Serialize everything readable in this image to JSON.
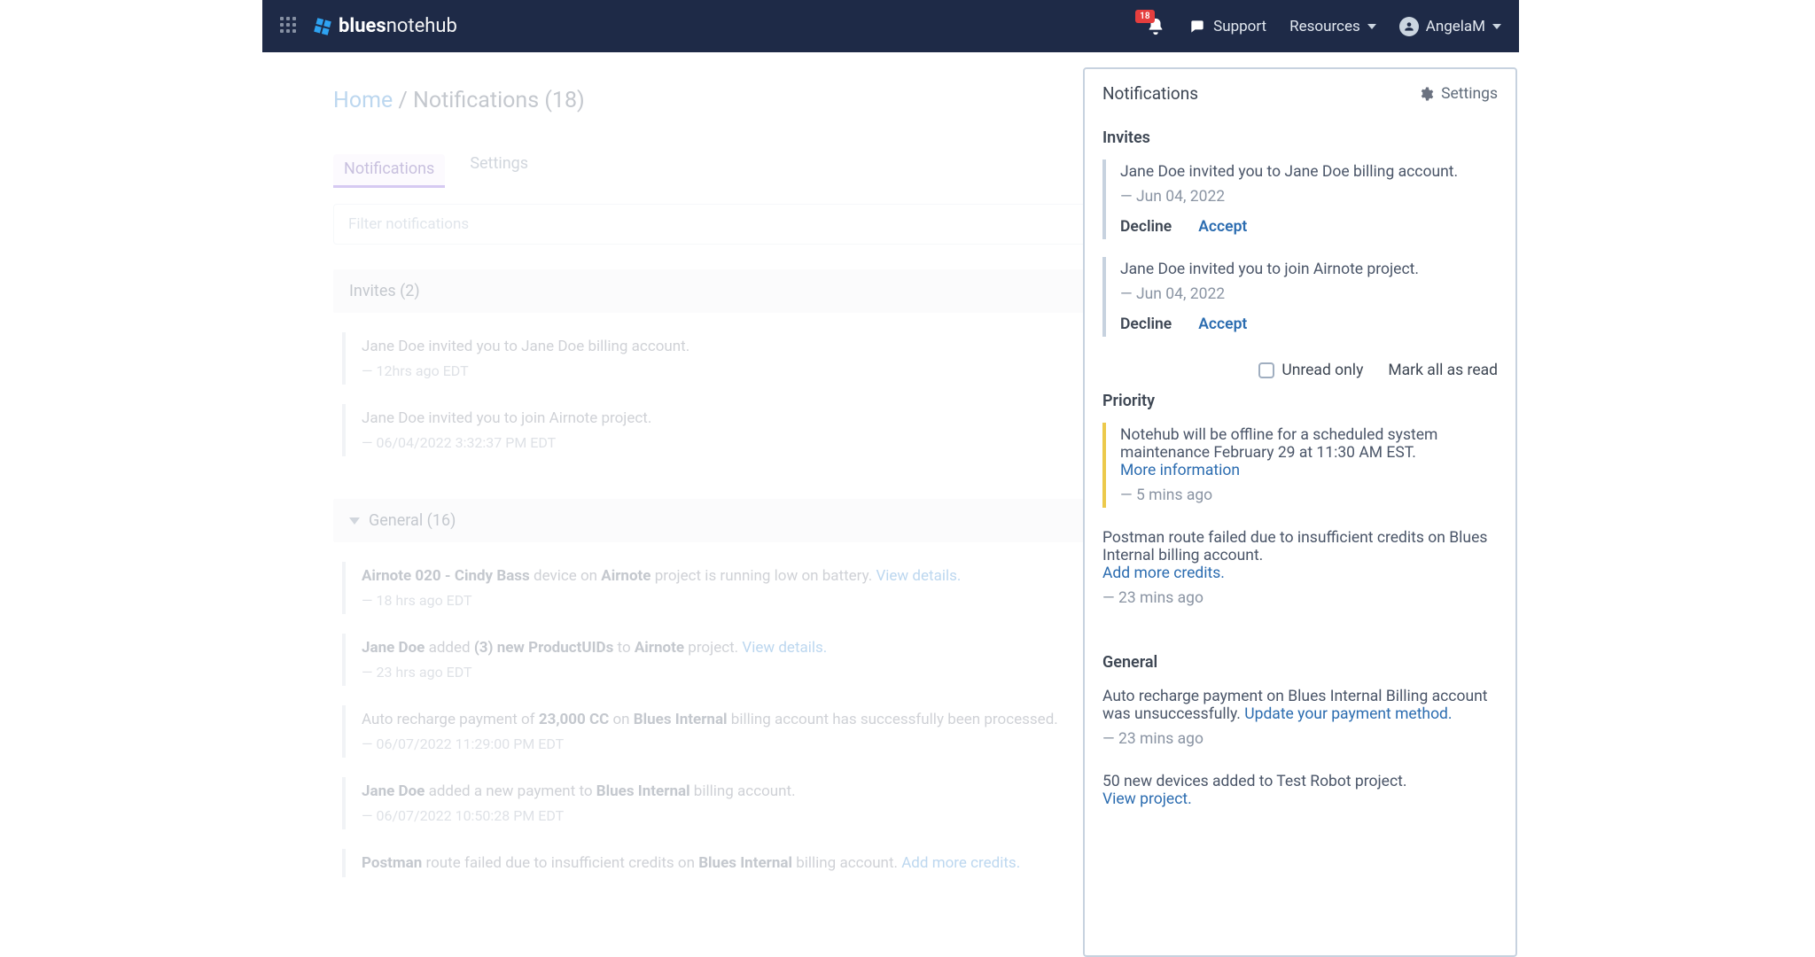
{
  "topbar": {
    "brand_blues": "blues",
    "brand_notehub": "notehub",
    "support": "Support",
    "resources": "Resources",
    "user": "AngelaM",
    "badge": "18"
  },
  "breadcrumb": {
    "home": "Home",
    "sep": "/",
    "current": "Notifications (18)"
  },
  "tabs": {
    "notifications": "Notifications",
    "settings": "Settings"
  },
  "filter_placeholder": "Filter notifications",
  "sections": {
    "invites_head": "Invites (2)",
    "general_head": "General (16)"
  },
  "main_items": {
    "inv1_text": "Jane Doe invited you to Jane Doe billing account.",
    "inv1_ts": "— 12hrs ago EDT",
    "inv2_text": "Jane Doe invited you to join Airnote project.",
    "inv2_ts": "— 06/04/2022 3:32:37 PM EDT",
    "g1_a": "Airnote 020 - Cindy Bass",
    "g1_b": " device on ",
    "g1_c": "Airnote",
    "g1_d": " project is running low on battery. ",
    "g1_link": "View details.",
    "g1_ts": "— 18 hrs ago EDT",
    "g2_a": "Jane Doe",
    "g2_b": " added ",
    "g2_c": "(3) new ProductUIDs",
    "g2_d": " to ",
    "g2_e": "Airnote",
    "g2_f": " project. ",
    "g2_link": "View details.",
    "g2_ts": "— 23 hrs ago EDT",
    "g3_a": "Auto recharge payment of ",
    "g3_b": "23,000 CC",
    "g3_c": " on ",
    "g3_d": "Blues Internal",
    "g3_e": " billing account has successfully been processed.",
    "g3_ts": "— 06/07/2022 11:29:00 PM EDT",
    "g4_a": "Jane Doe",
    "g4_b": " added a new payment to ",
    "g4_c": "Blues Internal",
    "g4_d": " billing account.",
    "g4_ts": "— 06/07/2022 10:50:28 PM EDT",
    "g5_a": "Postman",
    "g5_b": " route failed due to insufficient credits on ",
    "g5_c": "Blues Internal",
    "g5_d": " billing account. ",
    "g5_link": "Add more credits."
  },
  "panel": {
    "title": "Notifications",
    "settings": "Settings",
    "invites_title": "Invites",
    "inv1_text": "Jane Doe invited you to Jane Doe billing account.",
    "inv1_ts": "— Jun 04, 2022",
    "inv2_text": "Jane Doe invited you to join Airnote project.",
    "inv2_ts": "— Jun 04, 2022",
    "decline": "Decline",
    "accept": "Accept",
    "unread_only": "Unread only",
    "mark_all": "Mark all as read",
    "priority_title": "Priority",
    "pr1_text": "Notehub will be offline for a scheduled system maintenance February 29 at 11:30 AM EST.",
    "pr1_link": "More information",
    "pr1_ts": "— 5 mins ago",
    "pr2_text": "Postman route failed due to insufficient credits on Blues Internal billing account.",
    "pr2_link": "Add more credits.",
    "pr2_ts": "— 23 mins ago",
    "general_title": "General",
    "gn1_text": "Auto recharge payment on Blues Internal Billing account was unsuccessfully. ",
    "gn1_link": "Update your payment method.",
    "gn1_ts": "— 23 mins ago",
    "gn2_text": "50 new devices added to Test Robot project.",
    "gn2_link": "View project."
  }
}
